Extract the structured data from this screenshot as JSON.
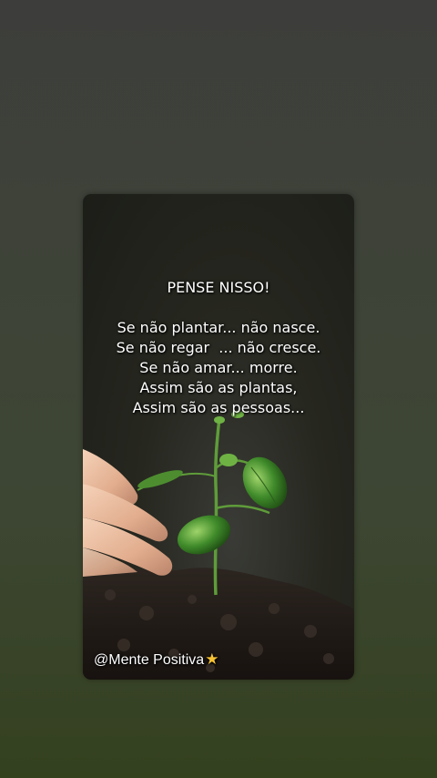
{
  "post": {
    "title": "PENSE NISSO!",
    "lines": [
      "Se não plantar... não nasce.",
      "Se não regar  ... não cresce.",
      "Se não amar... morre.",
      "Assim são as plantas,",
      "Assim são as pessoas..."
    ],
    "watermark": "@Mente Positiva",
    "star_icon": "star-icon"
  },
  "colors": {
    "background_top": "#3d3e3b",
    "background_bottom": "#34411f",
    "text": "#ffffff",
    "star": "#f6c233",
    "leaf": "#3f8a2a"
  }
}
